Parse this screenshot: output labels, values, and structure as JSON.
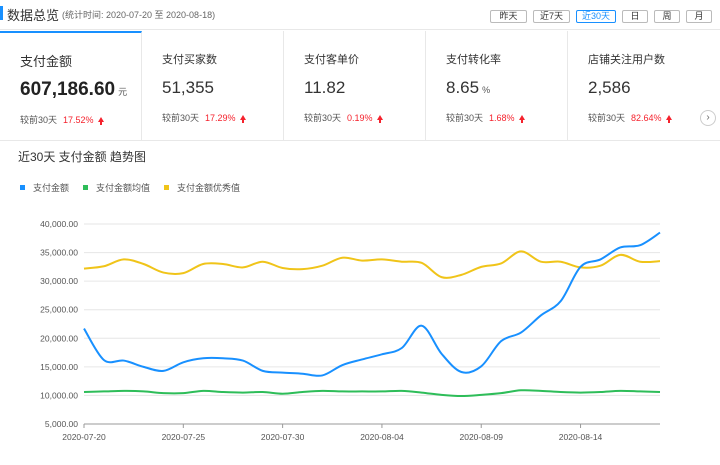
{
  "header": {
    "title": "数据总览",
    "subtitle": "(统计时间: 2020-07-20 至 2020-08-18)",
    "ranges": [
      {
        "label": "昨天",
        "active": false
      },
      {
        "label": "近7天",
        "active": false
      },
      {
        "label": "近30天",
        "active": true
      },
      {
        "label": "日",
        "active": false
      },
      {
        "label": "周",
        "active": false
      },
      {
        "label": "月",
        "active": false
      }
    ]
  },
  "kpis": [
    {
      "label": "支付金额",
      "value": "607,186.60",
      "unit": "元",
      "compare_label": "较前30天",
      "change": "17.52%",
      "active": true
    },
    {
      "label": "支付买家数",
      "value": "51,355",
      "unit": "",
      "compare_label": "较前30天",
      "change": "17.29%",
      "active": false
    },
    {
      "label": "支付客单价",
      "value": "11.82",
      "unit": "",
      "compare_label": "较前30天",
      "change": "0.19%",
      "active": false
    },
    {
      "label": "支付转化率",
      "value": "8.65",
      "unit": "%",
      "compare_label": "较前30天",
      "change": "1.68%",
      "active": false
    },
    {
      "label": "店铺关注用户数",
      "value": "2,586",
      "unit": "",
      "compare_label": "较前30天",
      "change": "82.64%",
      "active": false
    }
  ],
  "icons": {
    "next": "chevron-right-icon",
    "increase": "arrow-up-icon"
  },
  "colors": {
    "accent": "#1890ff",
    "increase": "#f5222d"
  },
  "chart_title": "近30天 支付金额 趋势图",
  "chart_data": {
    "type": "line",
    "ylim": [
      5000,
      40000
    ],
    "y_ticks": [
      "5,000.00",
      "10,000.00",
      "15,000.00",
      "20,000.00",
      "25,000.00",
      "30,000.00",
      "35,000.00",
      "40,000.00"
    ],
    "y_tick_values": [
      5000,
      10000,
      15000,
      20000,
      25000,
      30000,
      35000,
      40000
    ],
    "x_tick_labels": [
      "2020-07-20",
      "2020-07-25",
      "2020-07-30",
      "2020-08-04",
      "2020-08-09",
      "2020-08-14"
    ],
    "x": [
      "2020-07-20",
      "2020-07-21",
      "2020-07-22",
      "2020-07-23",
      "2020-07-24",
      "2020-07-25",
      "2020-07-26",
      "2020-07-27",
      "2020-07-28",
      "2020-07-29",
      "2020-07-30",
      "2020-07-31",
      "2020-08-01",
      "2020-08-02",
      "2020-08-03",
      "2020-08-04",
      "2020-08-05",
      "2020-08-06",
      "2020-08-07",
      "2020-08-08",
      "2020-08-09",
      "2020-08-10",
      "2020-08-11",
      "2020-08-12",
      "2020-08-13",
      "2020-08-14",
      "2020-08-15",
      "2020-08-16",
      "2020-08-17",
      "2020-08-18"
    ],
    "grid": true,
    "legend_position": "top-left",
    "series": [
      {
        "name": "支付金额",
        "color": "#1890ff",
        "values": [
          21700,
          16200,
          16100,
          15000,
          14300,
          15800,
          16500,
          16500,
          16100,
          14300,
          14000,
          13800,
          13500,
          15300,
          16300,
          17200,
          18300,
          22200,
          17300,
          14100,
          15100,
          19500,
          21000,
          24000,
          26500,
          32500,
          33800,
          35900,
          36300,
          38500
        ]
      },
      {
        "name": "支付金额均值",
        "color": "#2ebd59",
        "values": [
          10600,
          10700,
          10800,
          10700,
          10400,
          10400,
          10800,
          10600,
          10500,
          10600,
          10300,
          10600,
          10800,
          10700,
          10700,
          10700,
          10800,
          10500,
          10100,
          9900,
          10100,
          10400,
          10900,
          10800,
          10600,
          10500,
          10600,
          10800,
          10700,
          10600
        ]
      },
      {
        "name": "支付金额优秀值",
        "color": "#f0c419",
        "values": [
          32200,
          32600,
          33800,
          33000,
          31500,
          31400,
          33000,
          33000,
          32400,
          33400,
          32300,
          32100,
          32700,
          34100,
          33600,
          33800,
          33400,
          33200,
          30700,
          31100,
          32500,
          33100,
          35200,
          33400,
          33400,
          32400,
          32700,
          34600,
          33400,
          33500
        ]
      }
    ]
  }
}
